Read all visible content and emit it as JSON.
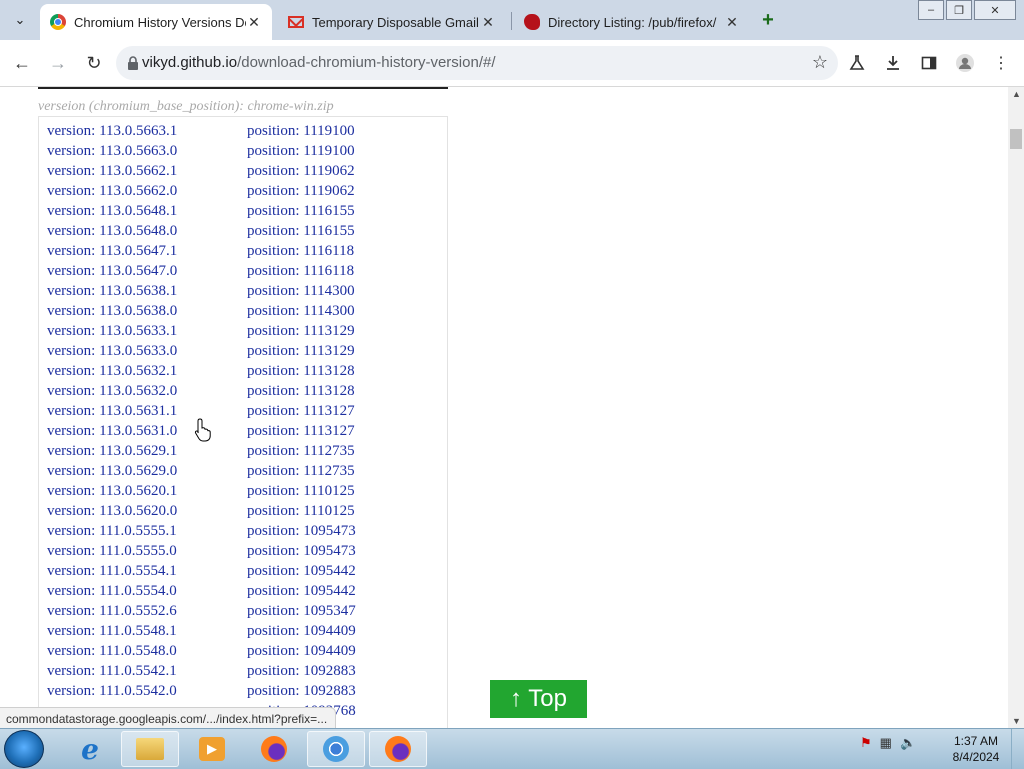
{
  "tabs": [
    {
      "title": "Chromium History Versions Do",
      "active": true
    },
    {
      "title": "Temporary Disposable Gmail |",
      "active": false
    },
    {
      "title": "Directory Listing: /pub/firefox/",
      "active": false
    }
  ],
  "address": {
    "host": "vikyd.github.io",
    "path": "/download-chromium-history-version/#/"
  },
  "page": {
    "caption": "verseion (chromium_base_position): chrome-win.zip",
    "top_button": "↑ Top",
    "rows": [
      {
        "version": "version: 113.0.5663.1",
        "position": "position: 1119100"
      },
      {
        "version": "version: 113.0.5663.0",
        "position": "position: 1119100"
      },
      {
        "version": "version: 113.0.5662.1",
        "position": "position: 1119062"
      },
      {
        "version": "version: 113.0.5662.0",
        "position": "position: 1119062"
      },
      {
        "version": "version: 113.0.5648.1",
        "position": "position: 1116155"
      },
      {
        "version": "version: 113.0.5648.0",
        "position": "position: 1116155"
      },
      {
        "version": "version: 113.0.5647.1",
        "position": "position: 1116118"
      },
      {
        "version": "version: 113.0.5647.0",
        "position": "position: 1116118"
      },
      {
        "version": "version: 113.0.5638.1",
        "position": "position: 1114300"
      },
      {
        "version": "version: 113.0.5638.0",
        "position": "position: 1114300"
      },
      {
        "version": "version: 113.0.5633.1",
        "position": "position: 1113129"
      },
      {
        "version": "version: 113.0.5633.0",
        "position": "position: 1113129"
      },
      {
        "version": "version: 113.0.5632.1",
        "position": "position: 1113128"
      },
      {
        "version": "version: 113.0.5632.0",
        "position": "position: 1113128"
      },
      {
        "version": "version: 113.0.5631.1",
        "position": "position: 1113127"
      },
      {
        "version": "version: 113.0.5631.0",
        "position": "position: 1113127"
      },
      {
        "version": "version: 113.0.5629.1",
        "position": "position: 1112735"
      },
      {
        "version": "version: 113.0.5629.0",
        "position": "position: 1112735"
      },
      {
        "version": "version: 113.0.5620.1",
        "position": "position: 1110125"
      },
      {
        "version": "version: 113.0.5620.0",
        "position": "position: 1110125"
      },
      {
        "version": "version: 111.0.5555.1",
        "position": "position: 1095473"
      },
      {
        "version": "version: 111.0.5555.0",
        "position": "position: 1095473"
      },
      {
        "version": "version: 111.0.5554.1",
        "position": "position: 1095442"
      },
      {
        "version": "version: 111.0.5554.0",
        "position": "position: 1095442"
      },
      {
        "version": "version: 111.0.5552.6",
        "position": "position: 1095347"
      },
      {
        "version": "version: 111.0.5548.1",
        "position": "position: 1094409"
      },
      {
        "version": "version: 111.0.5548.0",
        "position": "position: 1094409"
      },
      {
        "version": "version: 111.0.5542.1",
        "position": "position: 1092883"
      },
      {
        "version": "version: 111.0.5542.0",
        "position": "position: 1092883"
      },
      {
        "version": "",
        "position": "position: 1092768"
      }
    ]
  },
  "status_url": "commondatastorage.googleapis.com/.../index.html?prefix=...",
  "clock": {
    "time": "1:37 AM",
    "date": "8/4/2024"
  },
  "colors": {
    "link": "#1d2fa0",
    "top_button": "#22a630",
    "tab_strip": "#cdd8e6"
  }
}
